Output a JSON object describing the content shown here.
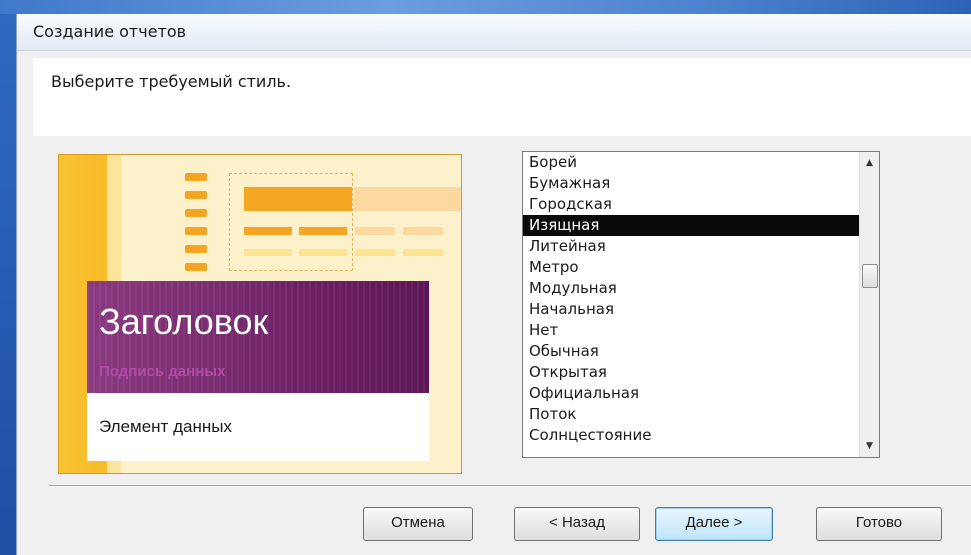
{
  "window": {
    "title": "Создание отчетов"
  },
  "prompt": "Выберите требуемый стиль.",
  "preview": {
    "title": "Заголовок",
    "subtitle": "Подпись данных",
    "data_element": "Элемент данных"
  },
  "style_list": {
    "items": [
      "Борей",
      "Бумажная",
      "Городская",
      "Изящная",
      "Литейная",
      "Метро",
      "Модульная",
      "Начальная",
      "Нет",
      "Обычная",
      "Открытая",
      "Официальная",
      "Поток",
      "Солнцестояние"
    ],
    "selected": "Изящная"
  },
  "buttons": {
    "cancel": "Отмена",
    "back": "< Назад",
    "next": "Далее >",
    "finish": "Готово"
  },
  "icons": {
    "scroll_up": "scroll-up-arrow-icon",
    "scroll_down": "scroll-down-arrow-icon"
  },
  "colors": {
    "selection": "#0a0a0a",
    "preview_accent": "#f5a623",
    "title_card": "#6a1f62"
  }
}
